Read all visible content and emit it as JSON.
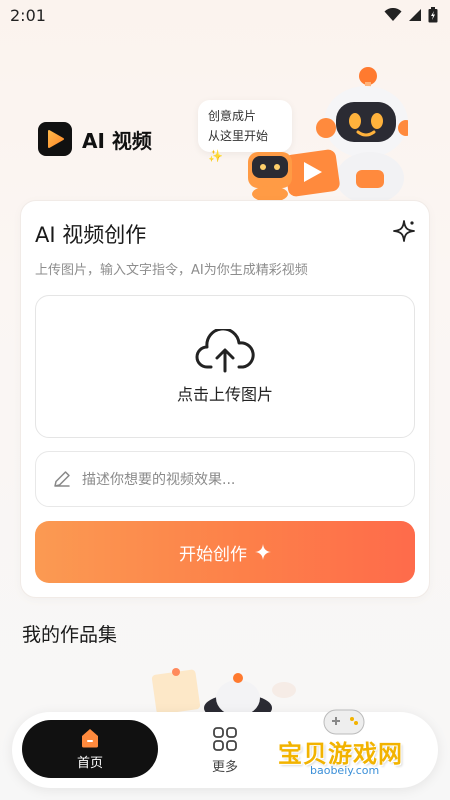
{
  "status_bar": {
    "time": "2:01"
  },
  "brand": {
    "name": "AI 视频"
  },
  "bubble": {
    "line1": "创意成片",
    "line2": "从这里开始",
    "sparkle": "✨"
  },
  "card": {
    "title": "AI 视频创作",
    "subtitle": "上传图片，输入文字指令，AI为你生成精彩视频",
    "upload_label": "点击上传图片",
    "prompt_placeholder": "描述你想要的视频效果...",
    "start_label": "开始创作"
  },
  "gallery": {
    "title": "我的作品集"
  },
  "nav": {
    "home_label": "首页",
    "more_label": "更多"
  },
  "watermark": {
    "title": "宝贝游戏网",
    "url": "baobeiy.com"
  },
  "colors": {
    "accent": "#fd8049",
    "accent_end": "#fe6b4b",
    "dark": "#111111"
  },
  "icons": [
    "signal-icon",
    "wifi-icon",
    "battery-icon",
    "play-logo-icon",
    "sparkle-icon",
    "cloud-upload-icon",
    "pencil-icon",
    "home-icon",
    "grid-icon"
  ]
}
